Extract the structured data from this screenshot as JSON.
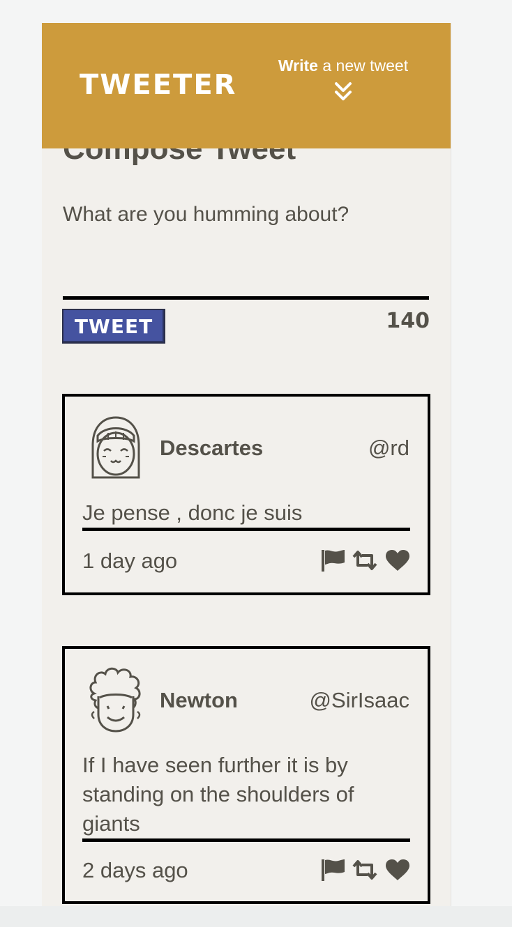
{
  "header": {
    "brand": "TWEETER",
    "write_strong": "Write",
    "write_rest": " a new tweet"
  },
  "compose": {
    "title": "Compose Tweet",
    "placeholder": "What are you humming about?",
    "button_label": "TWEET",
    "counter": "140"
  },
  "tweets": [
    {
      "name": "Descartes",
      "handle": "@rd",
      "text": "Je pense , donc je suis",
      "time": "1 day ago",
      "avatar_icon": "girl-avatar-icon"
    },
    {
      "name": "Newton",
      "handle": "@SirIsaac",
      "text": "If I have seen further it is by standing on the shoulders of giants",
      "time": "2 days ago",
      "avatar_icon": "curly-hair-avatar-icon"
    }
  ],
  "actions": [
    "flag-icon",
    "retweet-icon",
    "heart-icon"
  ],
  "colors": {
    "header_bg": "#cd9b3c",
    "button_bg": "#4553a0",
    "text": "#545149",
    "page_bg": "#f2f0ec"
  }
}
